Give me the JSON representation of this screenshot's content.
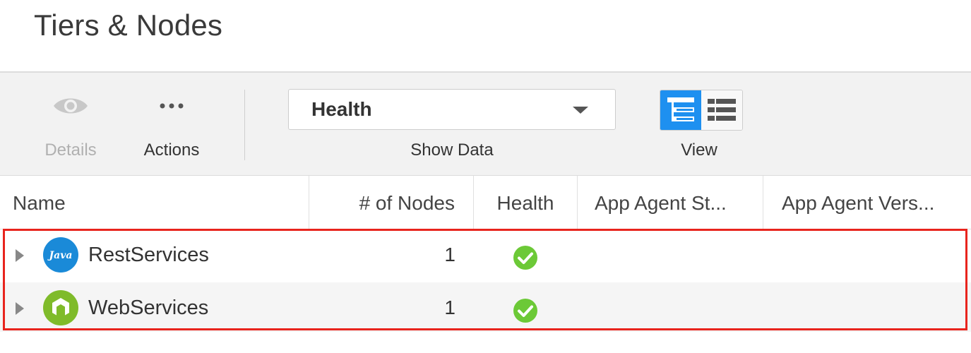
{
  "page": {
    "title": "Tiers & Nodes"
  },
  "toolbar": {
    "details_label": "Details",
    "actions_label": "Actions",
    "show_data": {
      "value": "Health",
      "label": "Show Data"
    },
    "view": {
      "label": "View",
      "selected": "tree"
    }
  },
  "table": {
    "columns": {
      "name": "Name",
      "nodes": "# of Nodes",
      "health": "Health",
      "agent_status": "App Agent St...",
      "agent_version": "App Agent Vers..."
    },
    "rows": [
      {
        "name": "RestServices",
        "nodes": "1",
        "health": "healthy",
        "icon": "java-icon",
        "icon_text": "Java"
      },
      {
        "name": "WebServices",
        "nodes": "1",
        "health": "healthy",
        "icon": "nodejs-icon",
        "icon_text": ""
      }
    ]
  },
  "colors": {
    "accent": "#1e90f0",
    "healthy": "#6cc937",
    "java": "#1a8ad8",
    "nodejs": "#7fbb2a",
    "highlight": "#e8241d"
  }
}
